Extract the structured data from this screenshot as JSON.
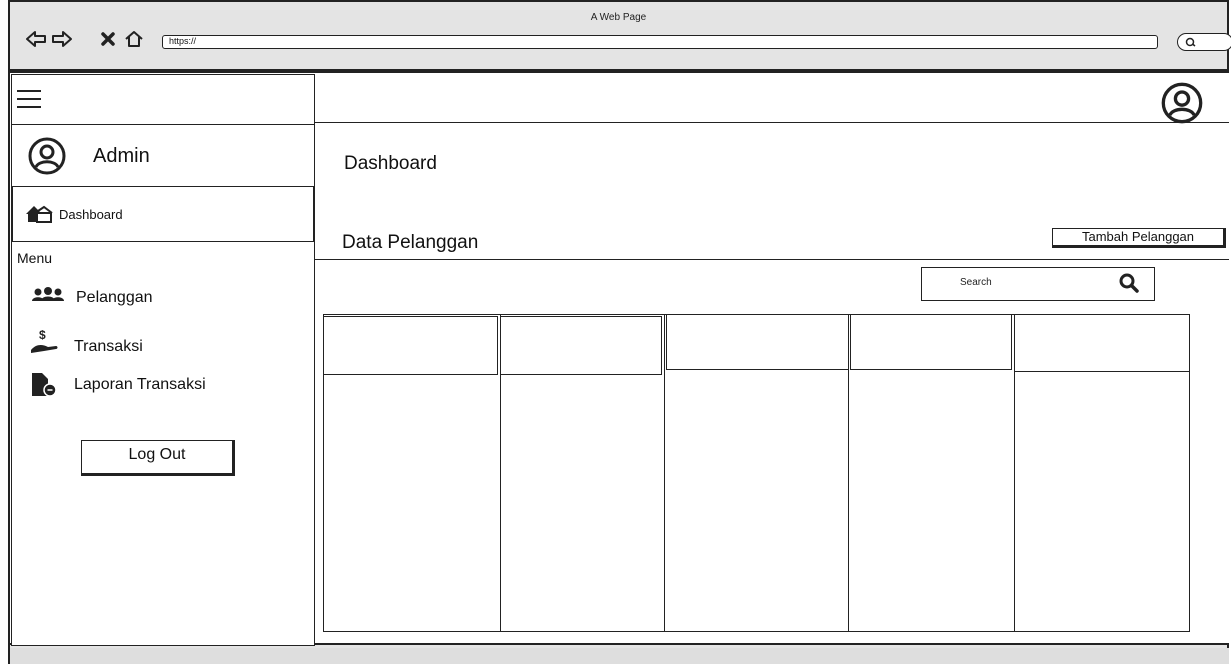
{
  "browser": {
    "title": "A Web Page",
    "url": "https://"
  },
  "sidebar": {
    "user_label": "Admin",
    "active_item": "Dashboard",
    "menu_heading": "Menu",
    "items": [
      {
        "label": "Pelanggan",
        "icon": "users-icon"
      },
      {
        "label": "Transaksi",
        "icon": "hand-dollar-icon"
      },
      {
        "label": "Laporan Transaksi",
        "icon": "file-report-icon"
      }
    ],
    "logout_label": "Log Out"
  },
  "main": {
    "page_title": "Dashboard",
    "section_title": "Data Pelanggan",
    "add_button": "Tambah Pelanggan",
    "search_placeholder": "Search"
  },
  "table": {
    "column_count": 5,
    "header_values": [
      "",
      "",
      "",
      "",
      ""
    ]
  },
  "colors": {
    "stroke": "#222222",
    "chrome": "#e4e4e4",
    "background": "#ffffff"
  }
}
